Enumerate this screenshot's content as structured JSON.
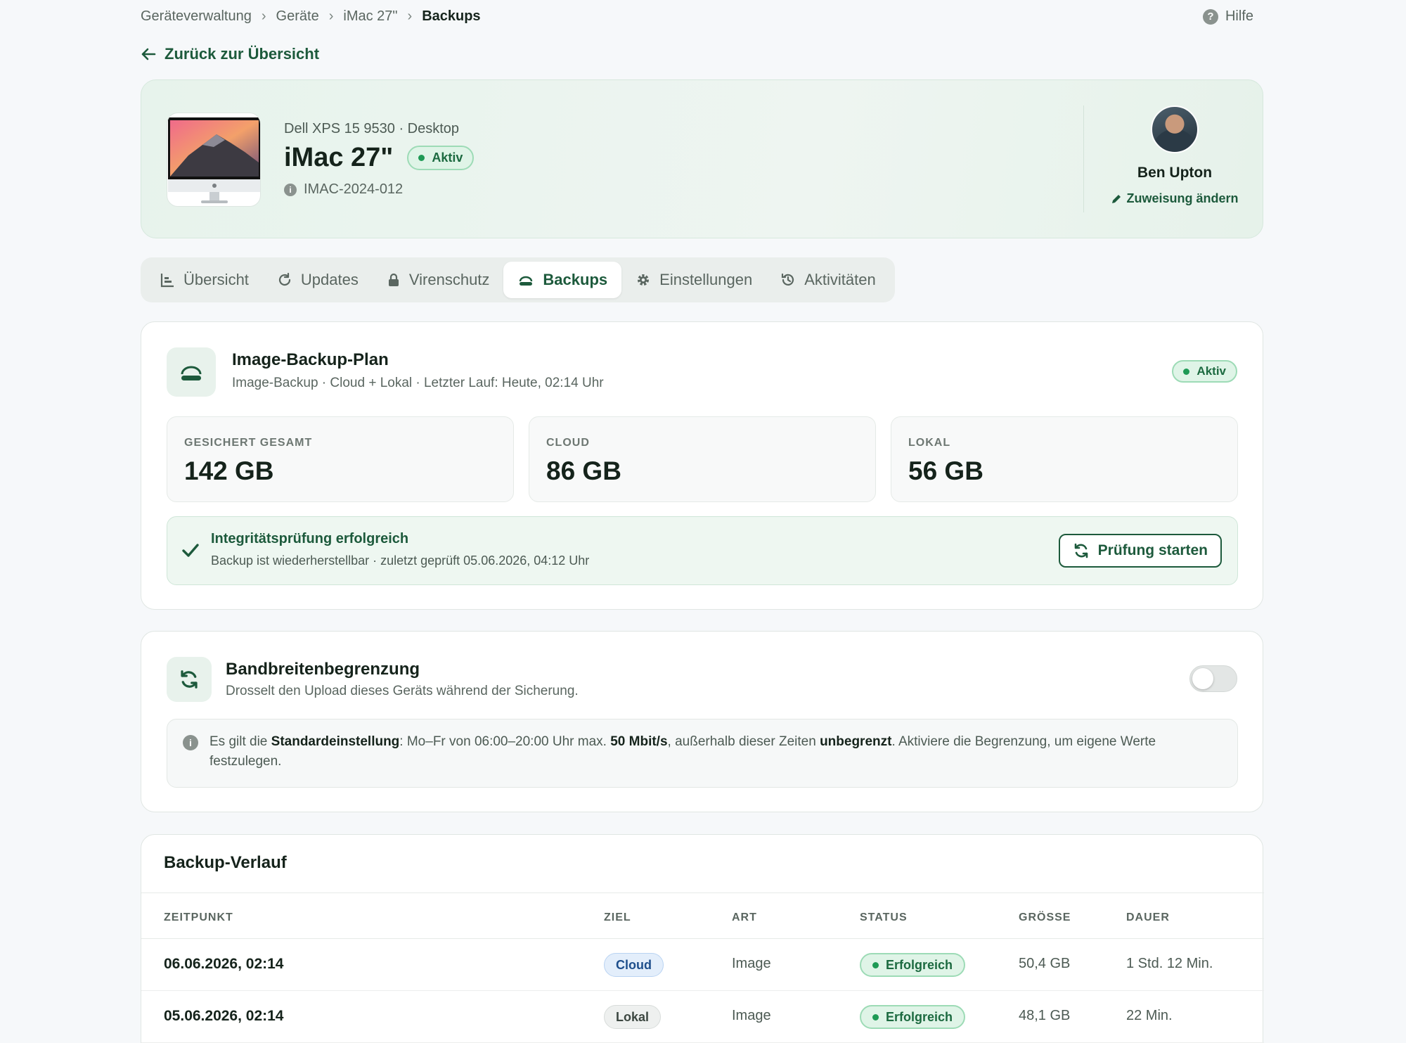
{
  "breadcrumb": {
    "items": [
      "Geräteverwaltung",
      "Geräte",
      "iMac 27\"",
      "Backups"
    ]
  },
  "help_label": "Hilfe",
  "back_label": "Zurück zur Übersicht",
  "device": {
    "subtitle": "Dell XPS 15 9530 · Desktop",
    "name": "iMac 27\"",
    "status": "Aktiv",
    "asset_id": "IMAC-2024-012"
  },
  "assignee": {
    "name": "Ben Upton",
    "change_label": "Zuweisung ändern"
  },
  "tabs": [
    {
      "label": "Übersicht",
      "icon": "chart-icon"
    },
    {
      "label": "Updates",
      "icon": "refresh-icon"
    },
    {
      "label": "Virenschutz",
      "icon": "lock-icon"
    },
    {
      "label": "Backups",
      "icon": "cloud-icon",
      "active": true
    },
    {
      "label": "Einstellungen",
      "icon": "gear-icon"
    },
    {
      "label": "Aktivitäten",
      "icon": "history-icon"
    }
  ],
  "backup_plan": {
    "title": "Image-Backup-Plan",
    "subtitle": "Image-Backup · Cloud + Lokal · Letzter Lauf: Heute, 02:14 Uhr",
    "status": "Aktiv",
    "stats": [
      {
        "label": "GESICHERT GESAMT",
        "value": "142 GB"
      },
      {
        "label": "CLOUD",
        "value": "86 GB"
      },
      {
        "label": "LOKAL",
        "value": "56 GB"
      }
    ],
    "integrity": {
      "title": "Integritätsprüfung erfolgreich",
      "subtitle": "Backup ist wiederherstellbar · zuletzt geprüft 05.06.2026, 04:12 Uhr",
      "button_label": "Prüfung starten"
    }
  },
  "bandwidth": {
    "title": "Bandbreitenbegrenzung",
    "subtitle": "Drosselt den Upload dieses Geräts während der Sicherung.",
    "enabled": false,
    "info": {
      "t1": "Es gilt die ",
      "b1": "Standardeinstellung",
      "t2": ": Mo–Fr von 06:00–20:00 Uhr max. ",
      "b2": "50 Mbit/s",
      "t3": ", außerhalb dieser Zeiten ",
      "b3": "unbegrenzt",
      "t4": ". Aktiviere die Begrenzung, um eigene Werte festzulegen."
    }
  },
  "history": {
    "title": "Backup-Verlauf",
    "columns": [
      "ZEITPUNKT",
      "ZIEL",
      "ART",
      "STATUS",
      "GRÖSSE",
      "DAUER"
    ],
    "rows": [
      {
        "time": "06.06.2026, 02:14",
        "target": "Cloud",
        "type": "Image",
        "status": "Erfolgreich",
        "size": "50,4 GB",
        "duration": "1 Std. 12 Min."
      },
      {
        "time": "05.06.2026, 02:14",
        "target": "Lokal",
        "type": "Image",
        "status": "Erfolgreich",
        "size": "48,1 GB",
        "duration": "22 Min."
      }
    ]
  },
  "colors": {
    "accent": "#1d5a3c",
    "success": "#1e9a55",
    "background": "#f6f8fa"
  }
}
